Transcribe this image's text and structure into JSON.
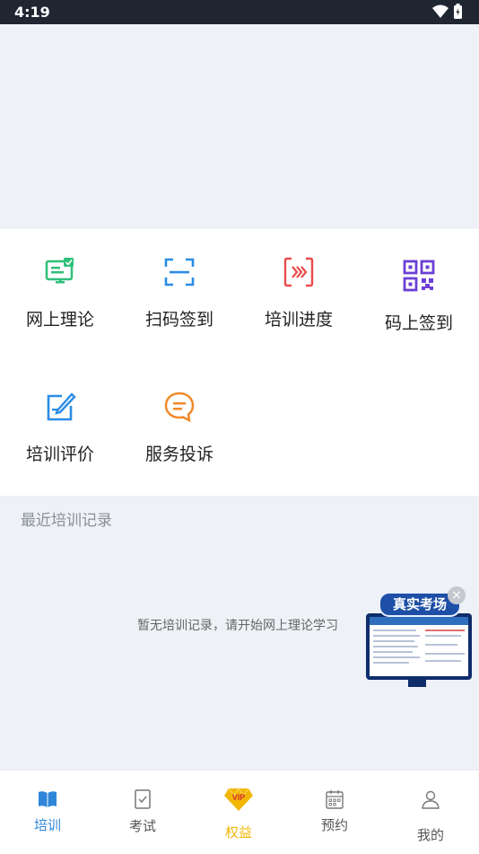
{
  "status": {
    "time": "4:19"
  },
  "menu": [
    {
      "label": "网上理论",
      "icon": "monitor-check-icon"
    },
    {
      "label": "扫码签到",
      "icon": "scan-frame-icon"
    },
    {
      "label": "培训进度",
      "icon": "progress-chevrons-icon"
    },
    {
      "label": "码上签到",
      "icon": "qr-code-icon"
    },
    {
      "label": "培训评价",
      "icon": "edit-note-icon"
    },
    {
      "label": "服务投诉",
      "icon": "message-bubble-icon"
    }
  ],
  "records": {
    "title": "最近培训记录",
    "empty": "暂无培训记录，请开始网上理论学习"
  },
  "promo": {
    "title": "真实考场",
    "close": "×"
  },
  "tabs": [
    {
      "label": "培训",
      "icon": "book-icon",
      "active": true
    },
    {
      "label": "考试",
      "icon": "exam-paper-icon",
      "active": false
    },
    {
      "label": "权益",
      "icon": "vip-diamond-icon",
      "active": false
    },
    {
      "label": "预约",
      "icon": "calendar-icon",
      "active": false
    },
    {
      "label": "我的",
      "icon": "user-icon",
      "active": false
    }
  ],
  "colors": {
    "active_tab": "#2f86d9",
    "vip": "#f2b705",
    "green": "#2fbf7a",
    "blue": "#2b8de6",
    "red": "#ea4b4b",
    "purple": "#6b3fd6",
    "orange": "#f08a2b"
  }
}
